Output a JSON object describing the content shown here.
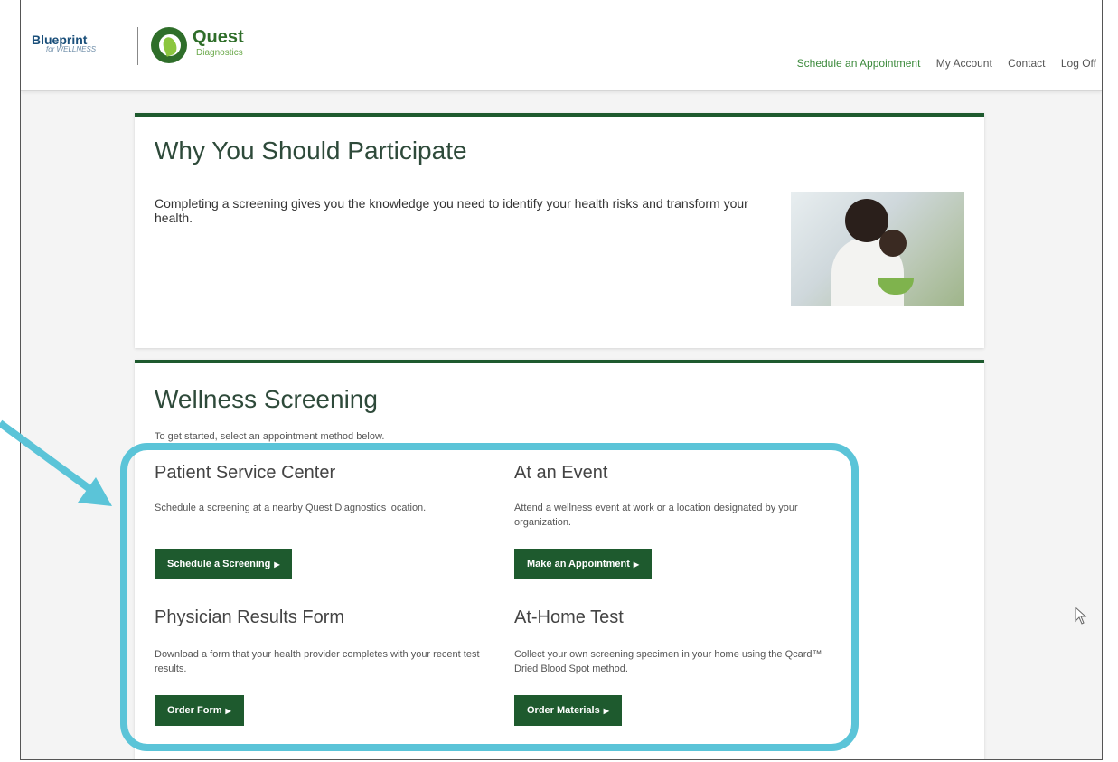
{
  "header": {
    "blueprint_title": "Blueprint",
    "blueprint_subtitle": "for WELLNESS",
    "quest_title": "Quest",
    "quest_subtitle": "Diagnostics",
    "nav": [
      "Schedule an Appointment",
      "My Account",
      "Contact",
      "Log Off"
    ]
  },
  "why": {
    "title": "Why You Should Participate",
    "text": "Completing a screening gives you the knowledge you need to identify your health risks and transform your health."
  },
  "wellness": {
    "title": "Wellness Screening",
    "intro": "To get started, select an appointment method below.",
    "options": [
      {
        "title": "Patient Service Center",
        "desc": "Schedule a screening at a nearby Quest Diagnostics location.",
        "button": "Schedule a Screening"
      },
      {
        "title": "At an Event",
        "desc": "Attend a wellness event at work or a location designated by your organization.",
        "button": "Make an Appointment"
      },
      {
        "title": "Physician Results Form",
        "desc": "Download a form that your health provider completes with your recent test results.",
        "button": "Order Form"
      },
      {
        "title": "At-Home Test",
        "desc": "Collect your own screening specimen in your home using the Qcard™ Dried Blood Spot method.",
        "button": "Order Materials"
      }
    ]
  },
  "colors": {
    "brand_green": "#1e5a2e",
    "highlight": "#5bc4d8"
  },
  "icons": [
    "quest-logo-icon",
    "arrow-pointer-icon",
    "mouse-cursor-icon",
    "button-arrow-icon"
  ]
}
